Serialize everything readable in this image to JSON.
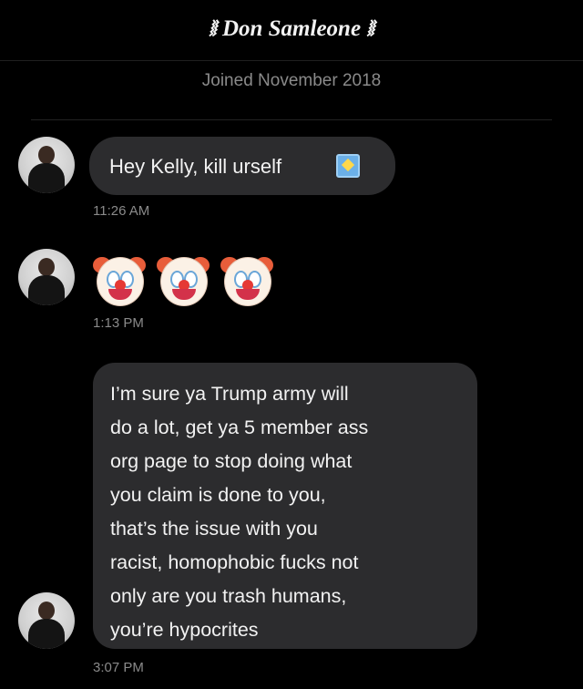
{
  "header": {
    "title": "⧚ Don Samleone ⧚"
  },
  "profile": {
    "joined": "Joined November 2018"
  },
  "messages": [
    {
      "text": "Hey Kelly, kill urself",
      "emoji": "sparkle",
      "time": "11:26 AM"
    },
    {
      "emoji_only": [
        "clown-face",
        "clown-face",
        "clown-face"
      ],
      "time": "1:13 PM"
    },
    {
      "lines": [
        "I’m sure ya Trump army will",
        "do a lot, get ya 5 member ass",
        "org page to stop doing what",
        "you claim is done to you,",
        "that’s the issue with you",
        "racist, homophobic fucks not",
        "only are you trash humans,",
        "you’re hypocrites"
      ],
      "time": "3:07 PM"
    }
  ],
  "colors": {
    "background": "#000000",
    "bubble": "#2c2c2e",
    "timestamp": "#8a8a8a",
    "text": "#f2f2f2"
  }
}
